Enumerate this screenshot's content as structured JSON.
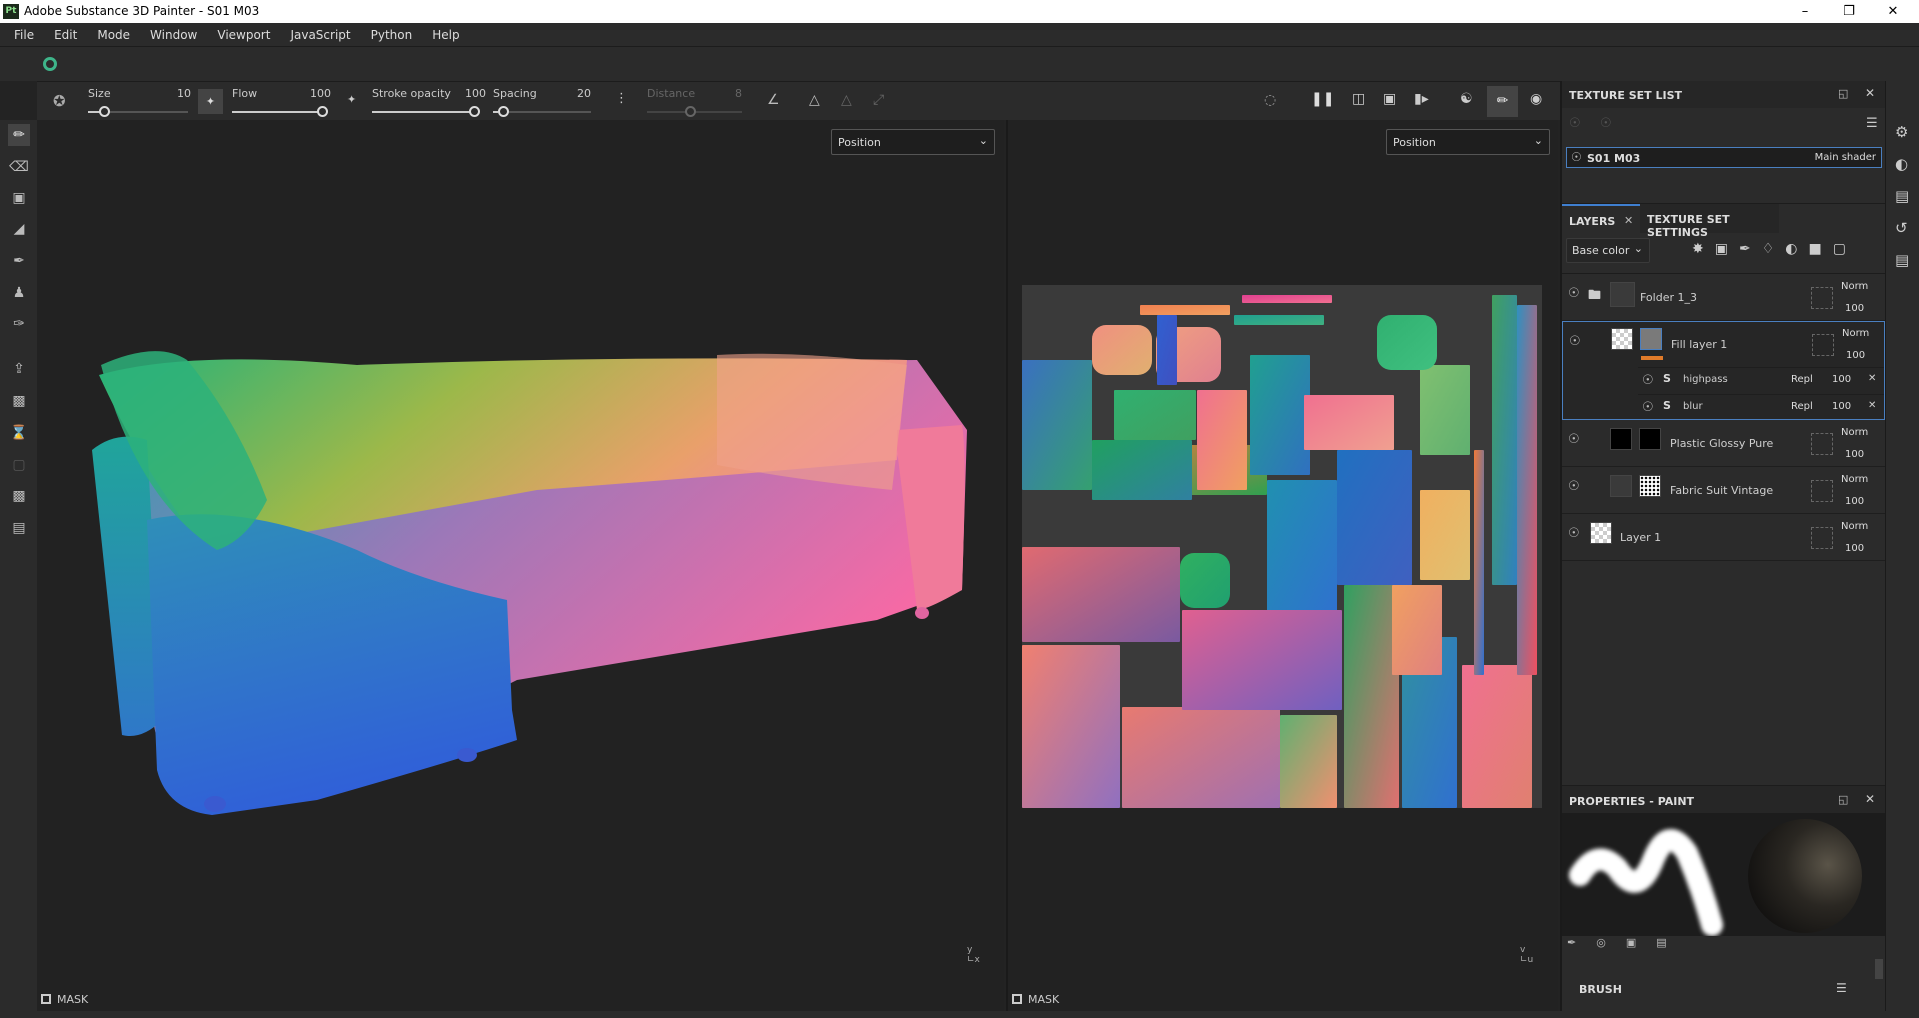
{
  "window": {
    "title": "Adobe Substance 3D Painter - S01 M03",
    "logo": "Pt"
  },
  "menu": [
    "File",
    "Edit",
    "Mode",
    "Window",
    "Viewport",
    "JavaScript",
    "Python",
    "Help"
  ],
  "tool_options": {
    "size": {
      "label": "Size",
      "value": "10",
      "fraction": 0.15
    },
    "flow": {
      "label": "Flow",
      "value": "100",
      "fraction": 1.0
    },
    "stroke_opacity": {
      "label": "Stroke opacity",
      "value": "100",
      "fraction": 1.0
    },
    "spacing": {
      "label": "Spacing",
      "value": "20",
      "fraction": 0.05
    },
    "distance": {
      "label": "Distance",
      "value": "8",
      "fraction": 0.4
    }
  },
  "viewports": {
    "left": {
      "channel": "Position",
      "mask_label": "MASK"
    },
    "right": {
      "channel": "Position",
      "mask_label": "MASK"
    }
  },
  "texture_set_list": {
    "title": "TEXTURE SET LIST",
    "item": {
      "name": "S01 M03",
      "shader": "Main shader"
    }
  },
  "layers_panel": {
    "tabs": [
      {
        "label": "LAYERS",
        "active": true
      },
      {
        "label": "TEXTURE SET SETTINGS",
        "active": false
      }
    ],
    "channel": "Base color",
    "layers": [
      {
        "name": "Folder 1_3",
        "blend": "Norm",
        "opacity": "100"
      },
      {
        "name": "Fill layer 1",
        "blend": "Norm",
        "opacity": "100",
        "effects": [
          {
            "name": "highpass",
            "blend": "Repl",
            "opacity": "100"
          },
          {
            "name": "blur",
            "blend": "Repl",
            "opacity": "100"
          }
        ]
      },
      {
        "name": "Plastic Glossy Pure",
        "blend": "Norm",
        "opacity": "100"
      },
      {
        "name": "Fabric Suit Vintage",
        "blend": "Norm",
        "opacity": "100"
      },
      {
        "name": "Layer 1",
        "blend": "Norm",
        "opacity": "100"
      }
    ]
  },
  "properties": {
    "title": "PROPERTIES - PAINT",
    "section": "BRUSH"
  },
  "colors": {
    "accent": "#3f7fd0",
    "selection": "#4a7fc0",
    "fill_orange": "#e07b2a"
  }
}
